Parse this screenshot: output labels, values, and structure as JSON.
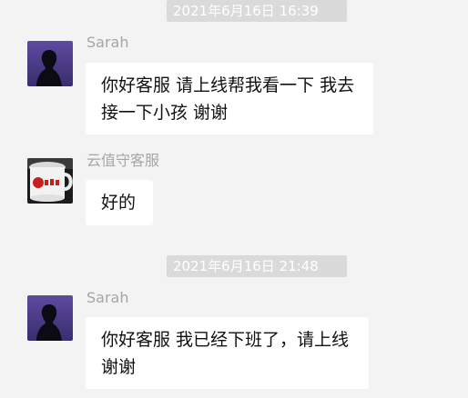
{
  "messages": [
    {
      "timestamp": "2021年6月16日 16:39",
      "sender": "Sarah",
      "avatar_icon": "sarah-silhouette-avatar",
      "text": "你好客服 请上线帮我看一下 我去接一下小孩 谢谢"
    },
    {
      "sender": "云值守客服",
      "avatar_icon": "mug-photo-avatar",
      "text": "好的"
    },
    {
      "timestamp": "2021年6月16日 21:48",
      "sender": "Sarah",
      "avatar_icon": "sarah-silhouette-avatar",
      "text": "你好客服 我已经下班了，请上线 谢谢"
    }
  ],
  "colors": {
    "background": "#f3f3f3",
    "bubble": "#ffffff",
    "timestamp_bg": "#dadada",
    "sender_text": "#a6a6a6"
  }
}
